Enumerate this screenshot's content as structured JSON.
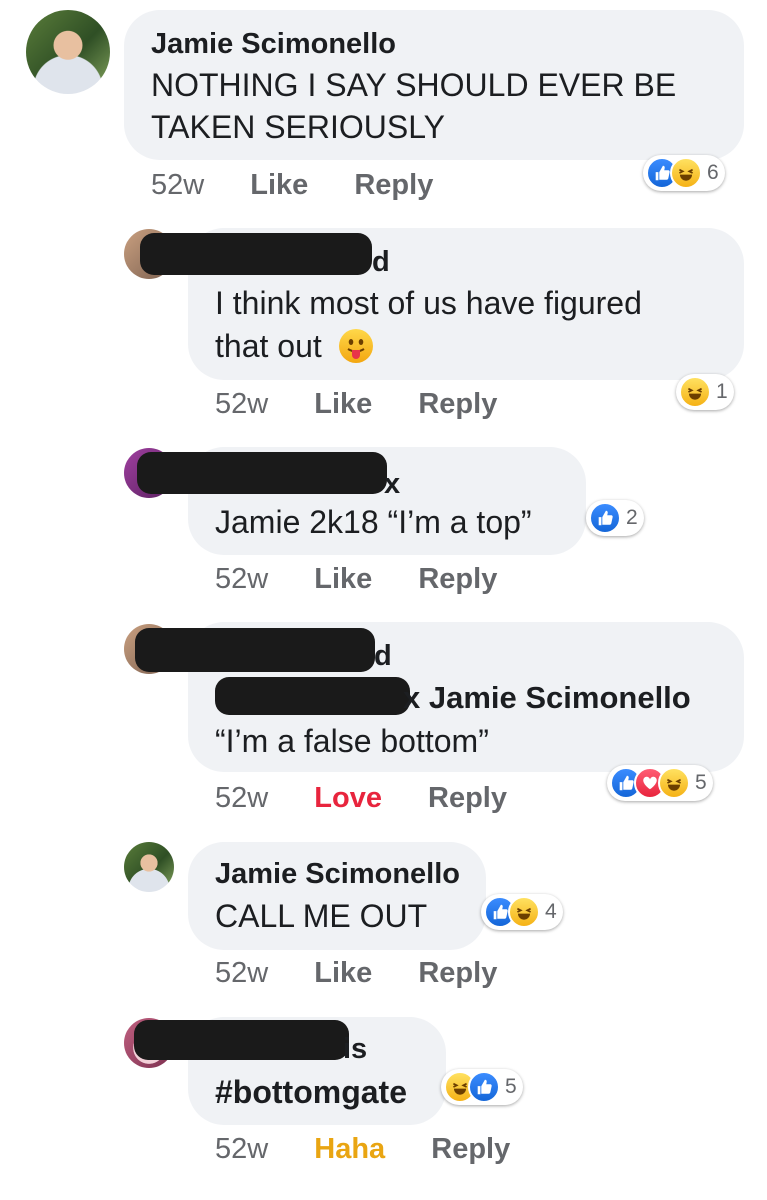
{
  "comments": [
    {
      "name": "Jamie Scimonello",
      "lines": [
        "NOTHING I SAY SHOULD EVER BE",
        "TAKEN SERIOUSLY"
      ],
      "time": "52w",
      "action1": "Like",
      "action2": "Reply",
      "reactions": [
        "like",
        "haha"
      ],
      "count": "6"
    },
    {
      "name_visible_fragment": "d",
      "lines": [
        "I think most of us have figured",
        "that out"
      ],
      "emoji": "face-with-tongue",
      "time": "52w",
      "action1": "Like",
      "action2": "Reply",
      "reactions": [
        "haha"
      ],
      "count": "1"
    },
    {
      "name_visible_fragment": "x",
      "lines": [
        "Jamie 2k18 “I’m a top”"
      ],
      "time": "52w",
      "action1": "Like",
      "action2": "Reply",
      "reactions": [
        "like"
      ],
      "count": "2"
    },
    {
      "name_visible_fragment": "d",
      "mention_fragment": "x Jamie Scimonello",
      "lines": [
        "“I’m a false bottom”"
      ],
      "time": "52w",
      "action1": "Love",
      "action2": "Reply",
      "reactions": [
        "like",
        "love",
        "haha"
      ],
      "count": "5"
    },
    {
      "name": "Jamie Scimonello",
      "lines": [
        "CALL ME OUT"
      ],
      "time": "52w",
      "action1": "Like",
      "action2": "Reply",
      "reactions": [
        "like",
        "haha"
      ],
      "count": "4"
    },
    {
      "name_visible_fragment": "is",
      "lines": [
        "#bottomgate"
      ],
      "time": "52w",
      "action1": "Haha",
      "action2": "Reply",
      "reactions": [
        "haha",
        "like"
      ],
      "count": "5"
    }
  ],
  "colors": {
    "bubble": "#f0f2f5",
    "meta": "#65676b",
    "love_action": "#e8243d",
    "haha_action": "#e9a512",
    "like_blue": "#1877f2"
  }
}
